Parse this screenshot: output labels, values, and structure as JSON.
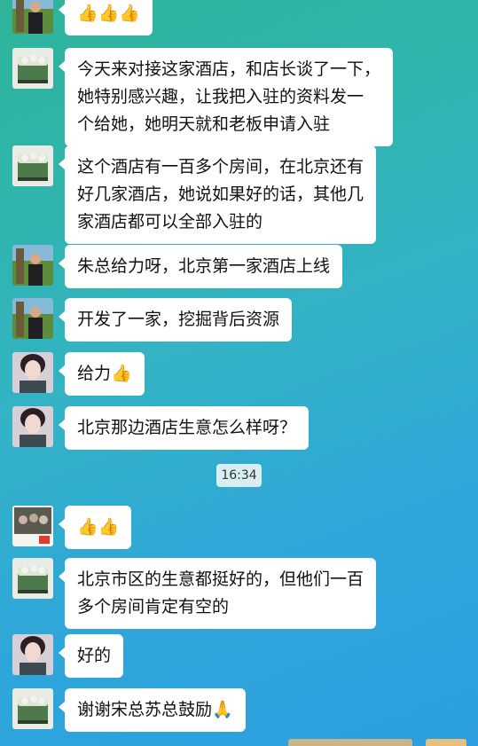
{
  "messages": [
    {
      "avatar": "man-park-avatar",
      "lines": [
        "👍👍👍"
      ]
    },
    {
      "avatar": "cake-avatar",
      "lines": [
        "今天来对接这家酒店，和店长谈了一下，",
        "她特别感兴趣，让我把入驻的资料发一",
        "个给她，她明天就和老板申请入驻"
      ]
    },
    {
      "avatar": "cake-avatar",
      "lines": [
        "这个酒店有一百多个房间，在北京还有",
        "好几家酒店，她说如果好的话，其他几",
        "家酒店都可以全部入驻的"
      ]
    },
    {
      "avatar": "man-park-avatar",
      "lines": [
        "朱总给力呀，北京第一家酒店上线"
      ]
    },
    {
      "avatar": "man-park-avatar",
      "lines": [
        "开发了一家，挖掘背后资源"
      ]
    },
    {
      "avatar": "woman-avatar",
      "lines": [
        "给力👍"
      ]
    },
    {
      "avatar": "woman-avatar",
      "lines": [
        "北京那边酒店生意怎么样呀？"
      ]
    },
    {
      "avatar": "group-photo-avatar",
      "lines": [
        "👍👍"
      ]
    },
    {
      "avatar": "cake-avatar",
      "lines": [
        "北京市区的生意都挺好的，但他们一百",
        "多个房间肯定有空的"
      ]
    },
    {
      "avatar": "woman-avatar",
      "lines": [
        "好的"
      ]
    },
    {
      "avatar": "cake-avatar",
      "lines": [
        "谢谢宋总苏总鼓励🙏"
      ]
    }
  ],
  "timestamp": "16:34"
}
